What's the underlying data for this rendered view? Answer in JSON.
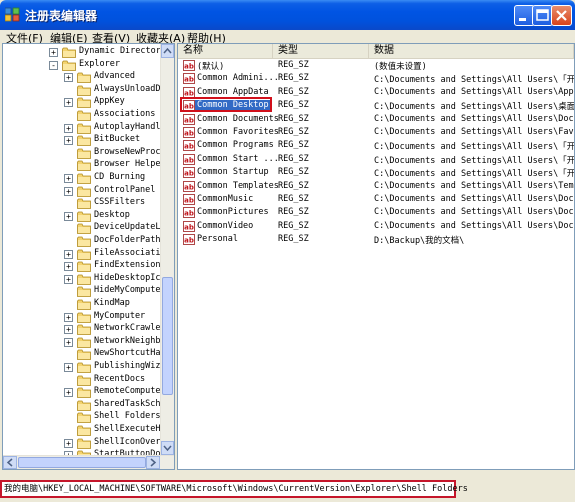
{
  "window": {
    "title": "注册表编辑器"
  },
  "menu": [
    "文件(F)",
    "编辑(E)",
    "查看(V)",
    "收藏夹(A)",
    "帮助(H)"
  ],
  "tree": {
    "items": [
      {
        "label": "Dynamic Directory",
        "depth": 0,
        "expander": "+"
      },
      {
        "label": "Explorer",
        "depth": 0,
        "expander": "-"
      },
      {
        "label": "Advanced",
        "depth": 1,
        "expander": "+"
      },
      {
        "label": "AlwaysUnloadDL",
        "depth": 1,
        "expander": ""
      },
      {
        "label": "AppKey",
        "depth": 1,
        "expander": "+"
      },
      {
        "label": "Associations",
        "depth": 1,
        "expander": ""
      },
      {
        "label": "AutoplayHandle",
        "depth": 1,
        "expander": "+"
      },
      {
        "label": "BitBucket",
        "depth": 1,
        "expander": "+"
      },
      {
        "label": "BrowseNewProce",
        "depth": 1,
        "expander": ""
      },
      {
        "label": "Browser Helper",
        "depth": 1,
        "expander": ""
      },
      {
        "label": "CD Burning",
        "depth": 1,
        "expander": "+"
      },
      {
        "label": "ControlPanel",
        "depth": 1,
        "expander": "+"
      },
      {
        "label": "CSSFilters",
        "depth": 1,
        "expander": ""
      },
      {
        "label": "Desktop",
        "depth": 1,
        "expander": "+"
      },
      {
        "label": "DeviceUpdateLo",
        "depth": 1,
        "expander": ""
      },
      {
        "label": "DocFolderPaths",
        "depth": 1,
        "expander": ""
      },
      {
        "label": "FileAssociatio",
        "depth": 1,
        "expander": "+"
      },
      {
        "label": "FindExtensions",
        "depth": 1,
        "expander": "+"
      },
      {
        "label": "HideDesktopIco",
        "depth": 1,
        "expander": "+"
      },
      {
        "label": "HideMyComputer",
        "depth": 1,
        "expander": ""
      },
      {
        "label": "KindMap",
        "depth": 1,
        "expander": ""
      },
      {
        "label": "MyComputer",
        "depth": 1,
        "expander": "+"
      },
      {
        "label": "NetworkCrawler",
        "depth": 1,
        "expander": "+"
      },
      {
        "label": "NetworkNeighbo",
        "depth": 1,
        "expander": "+"
      },
      {
        "label": "NewShortcutHan",
        "depth": 1,
        "expander": ""
      },
      {
        "label": "PublishingWiza",
        "depth": 1,
        "expander": "+"
      },
      {
        "label": "RecentDocs",
        "depth": 1,
        "expander": ""
      },
      {
        "label": "RemoteComputer",
        "depth": 1,
        "expander": "+"
      },
      {
        "label": "SharedTaskSche",
        "depth": 1,
        "expander": ""
      },
      {
        "label": "Shell Folders",
        "depth": 1,
        "expander": ""
      },
      {
        "label": "ShellExecuteHo",
        "depth": 1,
        "expander": ""
      },
      {
        "label": "ShellIconOverl",
        "depth": 1,
        "expander": "+"
      },
      {
        "label": "StartButtonDoc",
        "depth": 1,
        "expander": "+"
      }
    ]
  },
  "list": {
    "columns": [
      "名称",
      "类型",
      "数据"
    ],
    "rows": [
      {
        "name": "(默认)",
        "type": "REG_SZ",
        "data": "(数值未设置)"
      },
      {
        "name": "Common Admini...",
        "type": "REG_SZ",
        "data": "C:\\Documents and Settings\\All Users\\「开始"
      },
      {
        "name": "Common AppData",
        "type": "REG_SZ",
        "data": "C:\\Documents and Settings\\All Users\\Appl"
      },
      {
        "name": "Common Desktop",
        "type": "REG_SZ",
        "data": "C:\\Documents and Settings\\All Users\\桌面",
        "selected": true
      },
      {
        "name": "Common Documents",
        "type": "REG_SZ",
        "data": "C:\\Documents and Settings\\All Users\\Docum"
      },
      {
        "name": "Common Favorites",
        "type": "REG_SZ",
        "data": "C:\\Documents and Settings\\All Users\\Favor"
      },
      {
        "name": "Common Programs",
        "type": "REG_SZ",
        "data": "C:\\Documents and Settings\\All Users\\「开始"
      },
      {
        "name": "Common Start ...",
        "type": "REG_SZ",
        "data": "C:\\Documents and Settings\\All Users\\「开始"
      },
      {
        "name": "Common Startup",
        "type": "REG_SZ",
        "data": "C:\\Documents and Settings\\All Users\\「开始"
      },
      {
        "name": "Common Templates",
        "type": "REG_SZ",
        "data": "C:\\Documents and Settings\\All Users\\Templ"
      },
      {
        "name": "CommonMusic",
        "type": "REG_SZ",
        "data": "C:\\Documents and Settings\\All Users\\Docum"
      },
      {
        "name": "CommonPictures",
        "type": "REG_SZ",
        "data": "C:\\Documents and Settings\\All Users\\Docum"
      },
      {
        "name": "CommonVideo",
        "type": "REG_SZ",
        "data": "C:\\Documents and Settings\\All Users\\Docum"
      },
      {
        "name": "Personal",
        "type": "REG_SZ",
        "data": "D:\\Backup\\我的文档\\"
      }
    ]
  },
  "status": {
    "path": "我的电脑\\HKEY_LOCAL_MACHINE\\SOFTWARE\\Microsoft\\Windows\\CurrentVersion\\Explorer\\Shell Folders"
  },
  "colors": {
    "titlebar": "#0054e3",
    "highlight": "#316ac5",
    "callout": "#d1101b",
    "chrome": "#ece9d8"
  },
  "icons": {
    "app": "registry-editor-icon",
    "folder": "folder-icon",
    "value": "string-value-icon"
  }
}
